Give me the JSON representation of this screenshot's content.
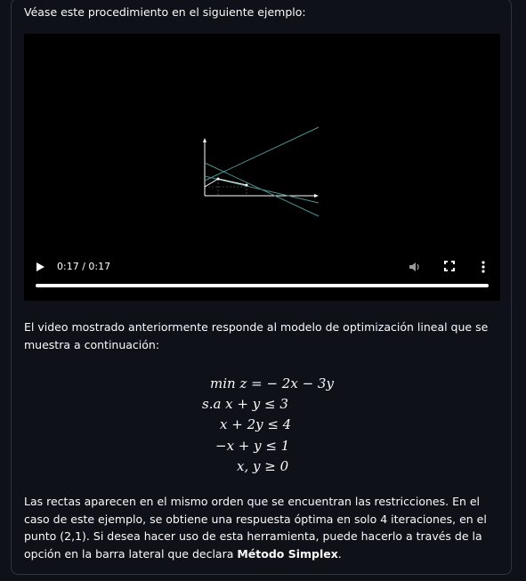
{
  "intro_text": "Véase este procedimiento en el siguiente ejemplo:",
  "video": {
    "time": "0:17 / 0:17",
    "progress_fraction": 1.0,
    "controls": {
      "play_icon": "play-icon",
      "volume_icon": "volume-icon",
      "fullscreen_icon": "fullscreen-icon",
      "more_icon": "more-options-icon"
    }
  },
  "paragraph1": "El video mostrado anteriormente responde al modelo de optimización lineal que se muestra a continuación:",
  "model": {
    "objective": "min z = − 2x − 3y",
    "constraint1": "s.a  x + y ≤ 3",
    "constraint2": "x + 2y ≤ 4",
    "constraint3": "−x + y ≤ 1",
    "nonneg": "x, y ≥ 0"
  },
  "paragraph2": {
    "text": "Las rectas aparecen en el mismo orden que se encuentran las restricciones. En el caso de este ejemplo, se obtiene una respuesta óptima en solo 4 iteraciones, en el punto (2,1). Si desea hacer uso de esta herramienta, puede hacerlo a través de la opción en la barra lateral que declara ",
    "bold": "Método Simplex",
    "end": "."
  },
  "colors": {
    "background": "#0e1117",
    "text": "#fafafa",
    "video_bg": "#000000",
    "line_color": "#4f8f8f"
  }
}
